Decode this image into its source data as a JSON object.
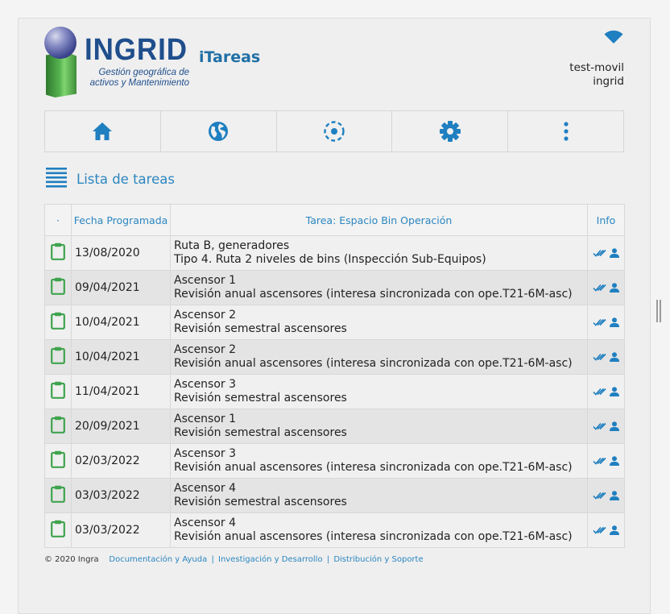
{
  "header": {
    "logo_word": "INGRID",
    "logo_sub_line1": "Gestión geográfica de",
    "logo_sub_line2": "activos y Mantenimiento",
    "app_title": "iTareas",
    "user": "test-movil",
    "org": "ingrid"
  },
  "toolbar": {
    "items": [
      {
        "icon": "home-icon"
      },
      {
        "icon": "globe-icon"
      },
      {
        "icon": "location-target-icon"
      },
      {
        "icon": "gear-icon"
      },
      {
        "icon": "more-vertical-icon"
      }
    ]
  },
  "section": {
    "title": "Lista de tareas",
    "icon": "list-icon"
  },
  "table": {
    "headers": [
      "·",
      "Fecha Programada",
      "Tarea: Espacio Bin Operación",
      "Info"
    ],
    "rows": [
      {
        "date": "13/08/2020",
        "line1": "Ruta B, generadores",
        "line2": "Tipo 4. Ruta 2 niveles de bins (Inspección Sub-Equipos)"
      },
      {
        "date": "09/04/2021",
        "line1": "Ascensor 1",
        "line2": "Revisión anual ascensores (interesa sincronizada con ope.T21-6M-asc)"
      },
      {
        "date": "10/04/2021",
        "line1": "Ascensor 2",
        "line2": "Revisión semestral ascensores"
      },
      {
        "date": "10/04/2021",
        "line1": "Ascensor 2",
        "line2": "Revisión anual ascensores (interesa sincronizada con ope.T21-6M-asc)"
      },
      {
        "date": "11/04/2021",
        "line1": "Ascensor 3",
        "line2": "Revisión semestral ascensores"
      },
      {
        "date": "20/09/2021",
        "line1": "Ascensor 1",
        "line2": "Revisión semestral ascensores"
      },
      {
        "date": "02/03/2022",
        "line1": "Ascensor 3",
        "line2": "Revisión anual ascensores (interesa sincronizada con ope.T21-6M-asc)"
      },
      {
        "date": "03/03/2022",
        "line1": "Ascensor 4",
        "line2": "Revisión semestral ascensores"
      },
      {
        "date": "03/03/2022",
        "line1": "Ascensor 4",
        "line2": "Revisión anual ascensores (interesa sincronizada con ope.T21-6M-asc)"
      }
    ]
  },
  "footer": {
    "copyright": "© 2020 Ingra",
    "links": [
      "Documentación y Ayuda",
      "Investigación y Desarrollo",
      "Distribución y Soporte"
    ],
    "separator": "|"
  },
  "colors": {
    "accent": "#2b86c0",
    "icon_blue": "#1f7fc0",
    "clipboard_green": "#3fa34d",
    "logo_blue": "#1f4e8c"
  }
}
